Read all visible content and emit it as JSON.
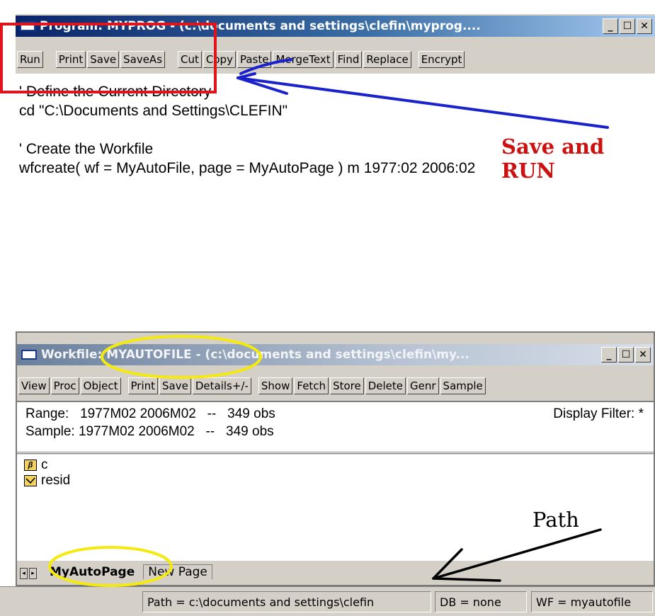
{
  "program_window": {
    "title": "Program: MYPROG - (c:\\documents and settings\\clefin\\myprog....",
    "toolbar": [
      "Run",
      "Print",
      "Save",
      "SaveAs",
      "Cut",
      "Copy",
      "Paste",
      "MergeText",
      "Find",
      "Replace",
      "Encrypt"
    ],
    "code_lines": [
      "' Define the Current Directory",
      "cd \"C:\\Documents and Settings\\CLEFIN\"",
      "",
      "' Create the Workfile",
      "wfcreate( wf = MyAutoFile, page = MyAutoPage ) m 1977:02 2006:02"
    ]
  },
  "workfile_window": {
    "title": "Workfile: MYAUTOFILE - (c:\\documents and settings\\clefin\\my...",
    "toolbar": [
      "View",
      "Proc",
      "Object",
      "Print",
      "Save",
      "Details+/-",
      "Show",
      "Fetch",
      "Store",
      "Delete",
      "Genr",
      "Sample"
    ],
    "range_line": "Range:   1977M02 2006M02   --   349 obs",
    "sample_line": "Sample: 1977M02 2006M02   --   349 obs",
    "display_filter": "Display Filter: *",
    "objects": [
      {
        "name": "c",
        "icon": "coefficient-icon"
      },
      {
        "name": "resid",
        "icon": "series-icon"
      }
    ],
    "tabs": [
      "MyAutoPage",
      "New Page"
    ]
  },
  "statusbar": {
    "path": "Path = c:\\documents and settings\\clefin",
    "db": "DB = none",
    "wf": "WF = myautofile"
  },
  "annotations": {
    "save_run": "Save and RUN",
    "path": "Path"
  },
  "colors": {
    "annotation_red": "#cc1111",
    "arrow_blue": "#1a22cc",
    "highlight_yellow": "#f4ea10"
  }
}
